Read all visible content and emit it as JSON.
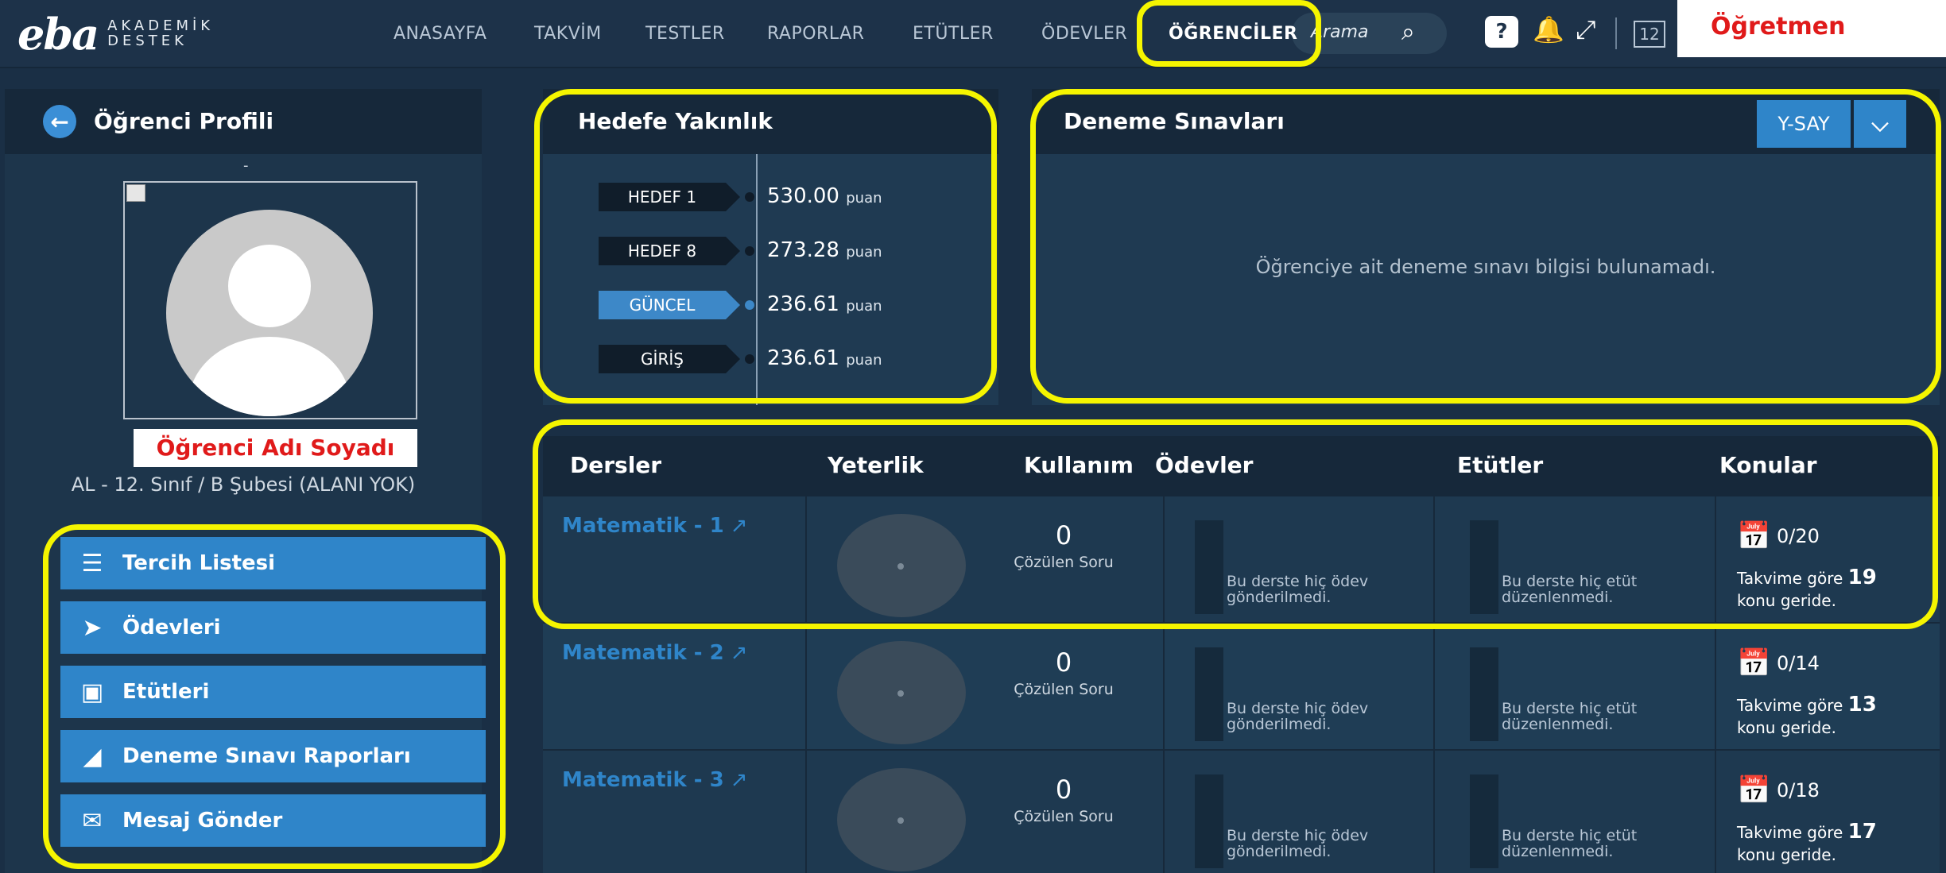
{
  "logo": {
    "mark": "eba",
    "line1": "AKADEMİK",
    "line2": "DESTEK"
  },
  "nav": {
    "items": [
      "ANASAYFA",
      "TAKVİM",
      "TESTLER",
      "RAPORLAR",
      "ETÜTLER",
      "ÖDEVLER",
      "ÖĞRENCİLER"
    ],
    "active": "ÖĞRENCİLER"
  },
  "search": {
    "placeholder": "Arama"
  },
  "toolbar": {
    "help": "?",
    "count": "12"
  },
  "role_label": "Öğretmen",
  "profile": {
    "title": "Öğrenci Profili",
    "sub": "-",
    "student_name": "Öğrenci Adı Soyadı",
    "class_info": "AL - 12. Sınıf / B Şubesi (ALANI YOK)",
    "menu": [
      {
        "label": "Tercih Listesi",
        "icon": "list-icon"
      },
      {
        "label": "Ödevleri",
        "icon": "send-icon"
      },
      {
        "label": "Etütleri",
        "icon": "board-icon"
      },
      {
        "label": "Deneme Sınavı Raporları",
        "icon": "area-chart-icon"
      },
      {
        "label": "Mesaj Gönder",
        "icon": "envelope-icon"
      }
    ]
  },
  "hedef": {
    "title": "Hedefe Yakınlık",
    "rows": [
      {
        "tag": "HEDEF 1",
        "value": "530.00",
        "unit": "puan",
        "current": false
      },
      {
        "tag": "HEDEF 8",
        "value": "273.28",
        "unit": "puan",
        "current": false
      },
      {
        "tag": "GÜNCEL",
        "value": "236.61",
        "unit": "puan",
        "current": true
      },
      {
        "tag": "GİRİŞ",
        "value": "236.61",
        "unit": "puan",
        "current": false
      }
    ]
  },
  "deneme": {
    "title": "Deneme Sınavları",
    "select_value": "Y-SAY",
    "empty_message": "Öğrenciye ait deneme sınavı bilgisi bulunamadı."
  },
  "table": {
    "headers": [
      "Dersler",
      "Yeterlik",
      "Kullanım",
      "Ödevler",
      "Etütler",
      "Konular"
    ],
    "rows": [
      {
        "course": "Matematik - 1",
        "solved": "0",
        "solved_label": "Çözülen Soru",
        "homework": "Bu derste hiç ödev gönderilmedi.",
        "study": "Bu derste hiç etüt düzenlenmedi.",
        "topics": "0/20",
        "behind_prefix": "Takvime göre",
        "behind": "19",
        "behind_suffix": "konu geride."
      },
      {
        "course": "Matematik - 2",
        "solved": "0",
        "solved_label": "Çözülen Soru",
        "homework": "Bu derste hiç ödev gönderilmedi.",
        "study": "Bu derste hiç etüt düzenlenmedi.",
        "topics": "0/14",
        "behind_prefix": "Takvime göre",
        "behind": "13",
        "behind_suffix": "konu geride."
      },
      {
        "course": "Matematik - 3",
        "solved": "0",
        "solved_label": "Çözülen Soru",
        "homework": "Bu derste hiç ödev gönderilmedi.",
        "study": "Bu derste hiç etüt düzenlenmedi.",
        "topics": "0/18",
        "behind_prefix": "Takvime göre",
        "behind": "17",
        "behind_suffix": "konu geride."
      }
    ]
  },
  "colors": {
    "highlight": "#f5f500",
    "accent": "#2f85c9",
    "role_text": "#e01a1a"
  }
}
